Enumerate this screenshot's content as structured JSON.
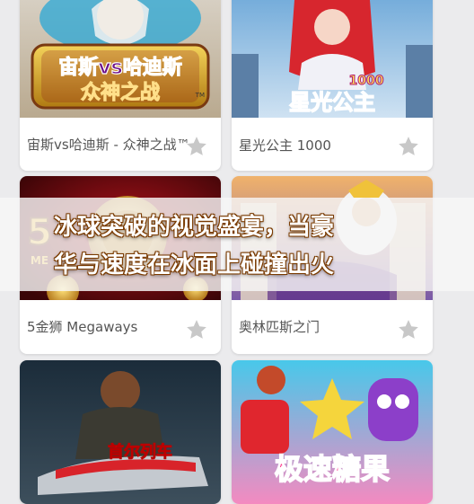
{
  "games": [
    {
      "title": "宙斯vs哈迪斯 - 众神之战™",
      "thumb_text_line1": "宙斯vs哈迪斯",
      "thumb_text_line2": "众神之战",
      "thumb_tm": "TM",
      "favorite": false
    },
    {
      "title": "星光公主 1000",
      "thumb_text_line1": "星光公主",
      "thumb_badge": "1000",
      "favorite": false
    },
    {
      "title": "5金狮 Megaways",
      "thumb_text_line1": "5",
      "thumb_text_line2": "ME",
      "favorite": false
    },
    {
      "title": "奥林匹斯之门",
      "favorite": false
    },
    {
      "title": "",
      "thumb_text_line1": "首尔列车",
      "favorite": false
    },
    {
      "title": "",
      "thumb_text_line1": "极速糖果",
      "favorite": false
    }
  ],
  "overlay": {
    "headline_line1": "冰球突破的视觉盛宴，当豪",
    "headline_line2": "华与速度在冰面上碰撞出火"
  },
  "colors": {
    "page_bg": "#ebebed",
    "card_bg": "#ffffff",
    "title_text": "#555555",
    "star": "#c8c8c8",
    "headline_fill": "#ffffff",
    "headline_outline": "#7a3b00"
  }
}
